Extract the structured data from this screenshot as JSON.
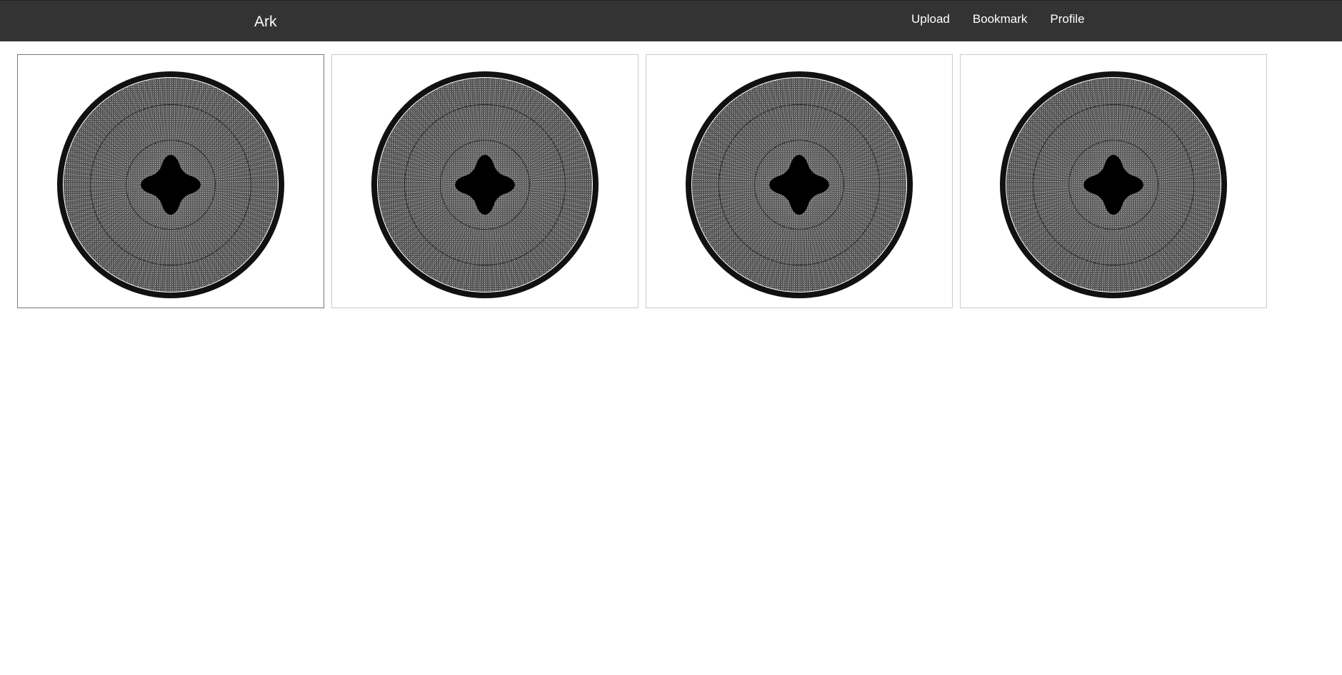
{
  "navbar": {
    "brand": "Ark",
    "links": [
      {
        "label": "Upload"
      },
      {
        "label": "Bookmark"
      },
      {
        "label": "Profile"
      }
    ],
    "background_color": "#333333",
    "text_color": "#ffffff"
  },
  "gallery": {
    "items": [
      {
        "selected": true
      },
      {
        "selected": false
      },
      {
        "selected": false
      },
      {
        "selected": false
      }
    ]
  }
}
